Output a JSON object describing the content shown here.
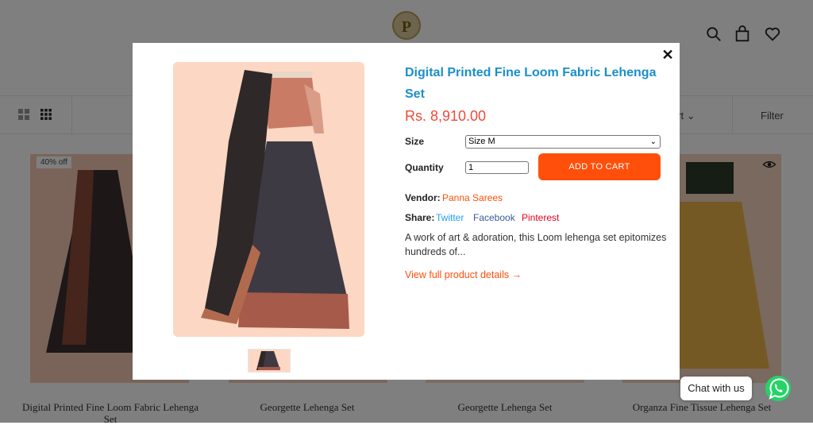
{
  "header": {
    "logo_letter": "P"
  },
  "toolbar": {
    "sort_label": "ort",
    "filter_label": "Filter"
  },
  "grid": {
    "badge": "40% off",
    "titles": [
      "Digital Printed Fine Loom Fabric Lehenga Set",
      "Georgette Lehenga Set",
      "Georgette Lehenga Set",
      "Organza Fine Tissue Lehenga Set"
    ]
  },
  "modal": {
    "close_glyph": "✕",
    "title": "Digital Printed Fine Loom Fabric Lehenga Set",
    "price": "Rs. 8,910.00",
    "size_label": "Size",
    "size_value": "Size M",
    "quantity_label": "Quantity",
    "quantity_value": "1",
    "add_to_cart": "ADD TO CART",
    "vendor_label": "Vendor:",
    "vendor_value": "Panna Sarees",
    "share_label": "Share:",
    "share_links": [
      "Twitter",
      "Facebook",
      "Pinterest"
    ],
    "description": "A work of art & adoration, this Loom lehenga set epitomizes hundreds of...",
    "view_full": "View full product details →"
  },
  "chat": {
    "label": "Chat with us"
  },
  "colors": {
    "accent": "#ff4f0a",
    "title_blue": "#1a8fc7",
    "price_red": "#ef4a3a",
    "twitter": "#1da1f2",
    "facebook": "#3b5998",
    "pinterest": "#e60023"
  }
}
